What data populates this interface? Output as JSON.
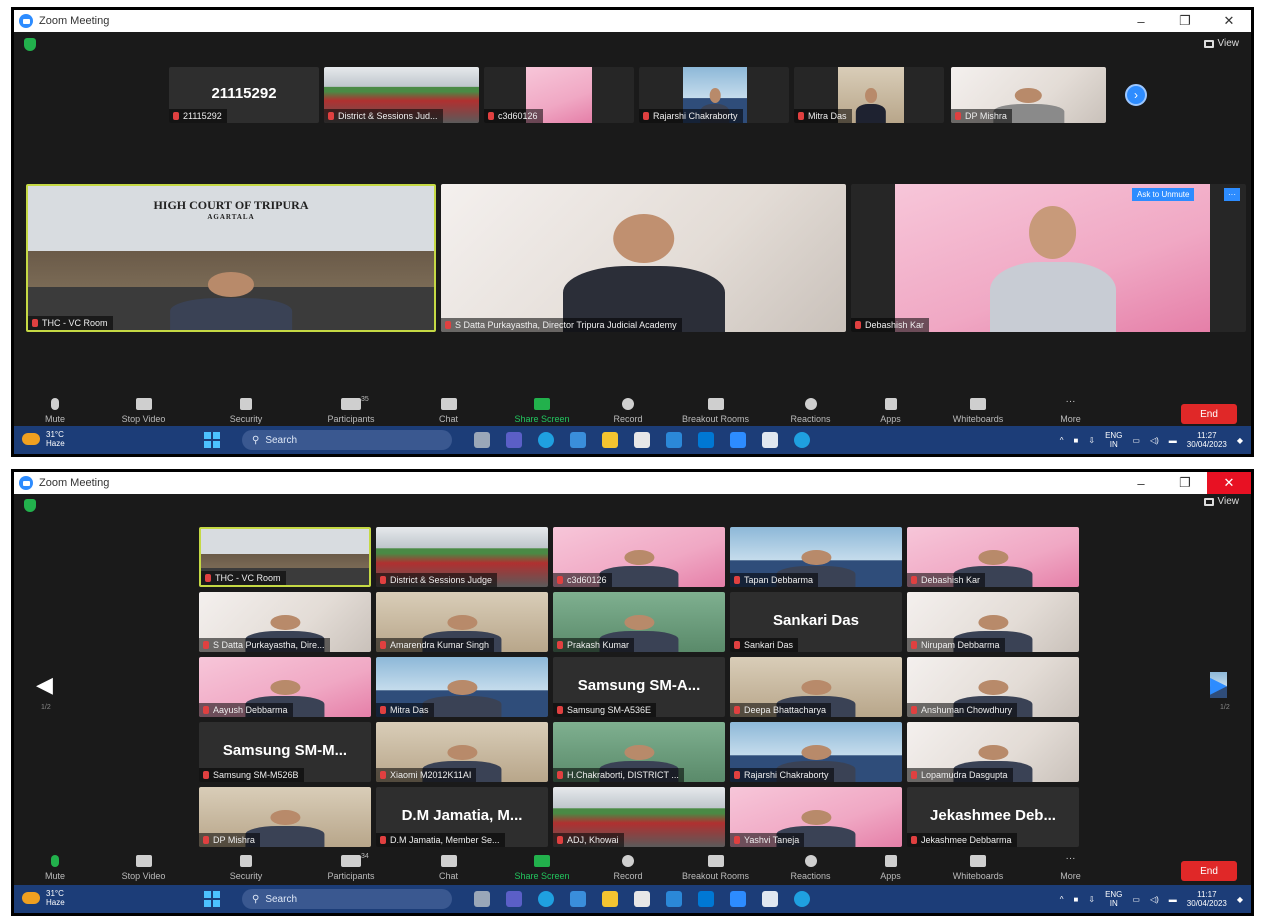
{
  "shotA": {
    "title": "Zoom Meeting",
    "view_label": "View",
    "top_tiles": [
      {
        "name": "21115292",
        "big": "21115292"
      },
      {
        "name": "District & Sessions Jud..."
      },
      {
        "name": "c3d60126"
      },
      {
        "name": "Rajarshi Chakraborty"
      },
      {
        "name": "Mitra Das"
      },
      {
        "name": "DP Mishra"
      }
    ],
    "main_tiles": [
      {
        "name": "THC - VC Room",
        "sign": "HIGH COURT OF TRIPURA",
        "sign_sub": "AGARTALA"
      },
      {
        "name": "S Datta Purkayastha, Director Tripura Judicial Academy"
      },
      {
        "name": "Debashish Kar"
      }
    ],
    "ask_label": "Ask to Unmute",
    "participants_count": "35",
    "time": "11:27",
    "date": "30/04/2023"
  },
  "shotB": {
    "title": "Zoom Meeting",
    "view_label": "View",
    "page_left": "1/2",
    "page_right": "1/2",
    "grid": [
      {
        "name": "THC - VC Room"
      },
      {
        "name": "District & Sessions Judge"
      },
      {
        "name": "c3d60126"
      },
      {
        "name": "Tapan Debbarma"
      },
      {
        "name": "Debashish Kar"
      },
      {
        "name": "S Datta Purkayastha, Dire..."
      },
      {
        "name": "Amarendra Kumar Singh"
      },
      {
        "name": "Prakash Kumar"
      },
      {
        "name": "Sankari Das",
        "big": "Sankari Das"
      },
      {
        "name": "Nirupam Debbarma"
      },
      {
        "name": "Aayush Debbarma"
      },
      {
        "name": "Mitra Das"
      },
      {
        "name": "Samsung SM-A536E",
        "big": "Samsung SM-A..."
      },
      {
        "name": "Deepa Bhattacharya"
      },
      {
        "name": "Anshuman Chowdhury"
      },
      {
        "name": "Samsung SM-M526B",
        "big": "Samsung SM-M..."
      },
      {
        "name": "Xiaomi M2012K11AI"
      },
      {
        "name": "H.Chakraborti, DISTRICT ..."
      },
      {
        "name": "Rajarshi Chakraborty"
      },
      {
        "name": "Lopamudra Dasgupta"
      },
      {
        "name": "DP Mishra"
      },
      {
        "name": "D.M Jamatia, Member Se...",
        "big": "D.M Jamatia, M..."
      },
      {
        "name": "ADJ, Khowai"
      },
      {
        "name": "Yashvi Taneja"
      },
      {
        "name": "Jekashmee Debbarma",
        "big": "Jekashmee Deb..."
      }
    ],
    "participants_count": "34",
    "time": "11:17",
    "date": "30/04/2023"
  },
  "toolbar": {
    "mute": "Mute",
    "stop_video": "Stop Video",
    "security": "Security",
    "participants": "Participants",
    "chat": "Chat",
    "share": "Share Screen",
    "record": "Record",
    "breakout": "Breakout Rooms",
    "reactions": "Reactions",
    "apps": "Apps",
    "whiteboards": "Whiteboards",
    "more": "More",
    "end": "End"
  },
  "taskbar": {
    "temp": "31°C",
    "weather": "Haze",
    "search": "Search",
    "lang1": "ENG",
    "lang2": "IN"
  },
  "colors": {
    "zoom_blue": "#2d8cff",
    "end_red": "#e02828",
    "share_green": "#22b14c",
    "taskbar": "#1c3d78"
  }
}
